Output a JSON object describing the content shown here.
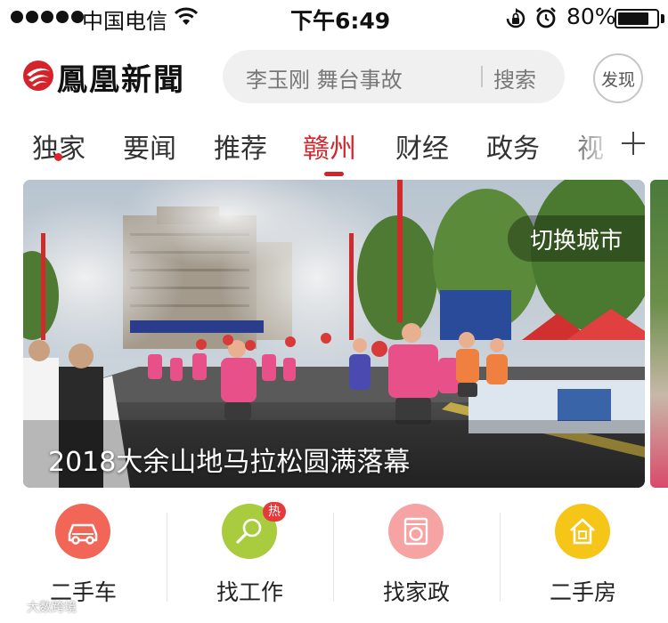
{
  "status_bar": {
    "carrier": "中国电信",
    "time": "下午6:49",
    "battery": "80%",
    "battery_level": 0.8,
    "icons": [
      "signal-dots-icon",
      "wifi-icon",
      "orientation-lock-icon",
      "alarm-icon",
      "battery-icon"
    ]
  },
  "header": {
    "logo_text": "鳳凰新聞",
    "search_placeholder": "李玉刚 舞台事故",
    "search_button": "搜索",
    "discover_label": "发现"
  },
  "tabs": {
    "items": [
      {
        "label": "独家"
      },
      {
        "label": "要闻"
      },
      {
        "label": "推荐"
      },
      {
        "label": "赣州",
        "active": true
      },
      {
        "label": "财经"
      },
      {
        "label": "政务"
      },
      {
        "label": "视"
      }
    ]
  },
  "banner": {
    "caption": "2018大余山地马拉松圆满落幕",
    "city_switch": "切换城市"
  },
  "services": {
    "items": [
      {
        "label": "二手车",
        "icon": "car-icon",
        "color": "#f26657"
      },
      {
        "label": "找工作",
        "icon": "magnifier-icon",
        "color": "#a8cc3e",
        "badge": "热"
      },
      {
        "label": "找家政",
        "icon": "washing-machine-icon",
        "color": "#f5a3a3"
      },
      {
        "label": "二手房",
        "icon": "house-icon",
        "color": "#f5c518"
      }
    ]
  },
  "watermark": "大数跨境",
  "colors": {
    "accent": "#d4232a",
    "badge": "#e63a3a"
  }
}
